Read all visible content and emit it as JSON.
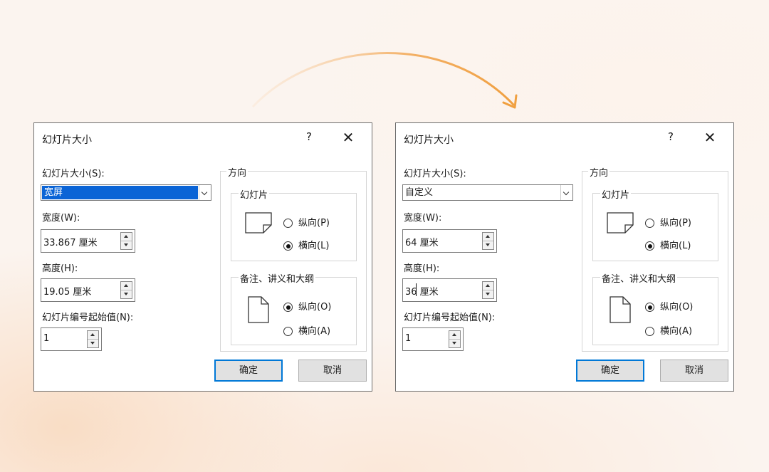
{
  "colors": {
    "arrow": "#f3a54d",
    "selection": "#0a64d6",
    "default_button_border": "#0078d7"
  },
  "dialogs": [
    {
      "title": "幻灯片大小",
      "help": "?",
      "close": "✕",
      "size_label": "幻灯片大小(S):",
      "size_value": "宽屏",
      "width_label": "宽度(W):",
      "width_value": "33.867 厘米",
      "height_label": "高度(H):",
      "height_value": "19.05 厘米",
      "number_label": "幻灯片编号起始值(N):",
      "number_value": "1",
      "orientation_group": "方向",
      "slides_group": "幻灯片",
      "slides_portrait": "纵向(P)",
      "slides_landscape": "横向(L)",
      "notes_group": "备注、讲义和大纲",
      "notes_portrait": "纵向(O)",
      "notes_landscape": "横向(A)",
      "ok": "确定",
      "cancel": "取消"
    },
    {
      "title": "幻灯片大小",
      "help": "?",
      "close": "✕",
      "size_label": "幻灯片大小(S):",
      "size_value": "自定义",
      "width_label": "宽度(W):",
      "width_value": "64 厘米",
      "height_label": "高度(H):",
      "height_value": "36 厘米",
      "number_label": "幻灯片编号起始值(N):",
      "number_value": "1",
      "orientation_group": "方向",
      "slides_group": "幻灯片",
      "slides_portrait": "纵向(P)",
      "slides_landscape": "横向(L)",
      "notes_group": "备注、讲义和大纲",
      "notes_portrait": "纵向(O)",
      "notes_landscape": "横向(A)",
      "ok": "确定",
      "cancel": "取消"
    }
  ]
}
